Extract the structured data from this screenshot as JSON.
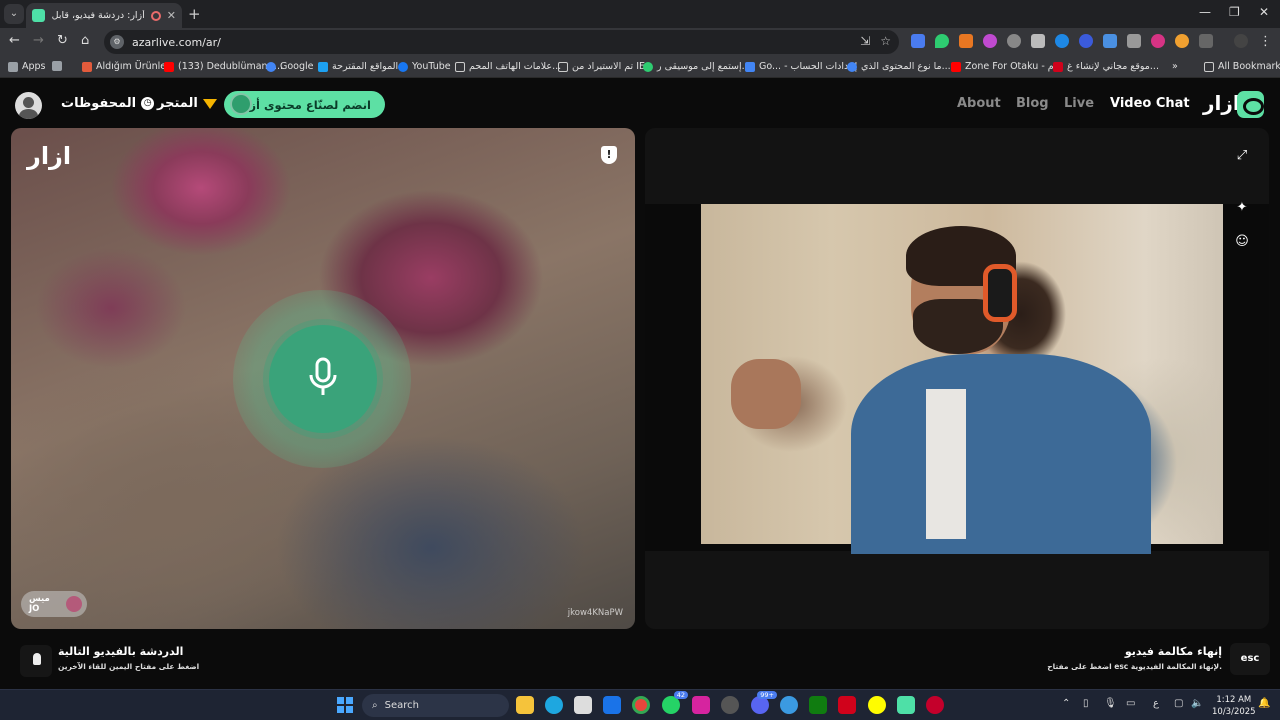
{
  "browser": {
    "tab_title": "أزار: دردشة فيديو، قابل الأصد...",
    "url": "azarlive.com/ar/",
    "bookmarks": [
      {
        "label": "Apps",
        "color": "#9aa0a6"
      },
      {
        "label": "Aldığım Ürünler",
        "color": "#e25b3c"
      },
      {
        "label": "(133) Dedublüman -...",
        "color": "#ff0000"
      },
      {
        "label": "Google",
        "color": "#4285f4"
      },
      {
        "label": "المواقع المقترحة",
        "color": "#1da1f2"
      },
      {
        "label": "YouTube",
        "color": "#1877f2"
      },
      {
        "label": "علامات الهاتف المحم...",
        "color": "#9aa0a6"
      },
      {
        "label": "تم الاستيراد من IE",
        "color": "#9aa0a6"
      },
      {
        "label": "إستمع إلى موسيقى ر...",
        "color": "#2ecc71"
      },
      {
        "label": "Go... - إعدادات الحساب",
        "color": "#4285f4"
      },
      {
        "label": "ما نوع المحتوى الذي...",
        "color": "#4285f4"
      },
      {
        "label": "Zone For Otaku - م...",
        "color": "#ff0000"
      },
      {
        "label": "موقع مجاني لإنشاء غ...",
        "color": "#d0021b"
      },
      {
        "label": "All Bookmarks",
        "color": "#9aa0a6"
      }
    ]
  },
  "header": {
    "saved_label": "المحفوظات",
    "store_label": "المتجر",
    "promo_label": "انضم لصنّاع محتوى أزار",
    "nav": {
      "about": "About",
      "blog": "Blog",
      "live": "Live",
      "video_chat": "Video Chat"
    },
    "logo_text": "ازار"
  },
  "left_video": {
    "watermark": "ازار",
    "report_icon": "!",
    "user_chip": {
      "name": "ميس",
      "country": "JO"
    },
    "user_id": "jkow4KNaPW"
  },
  "bottom": {
    "next_title": "الدردشة بالفيديو التالية",
    "next_sub": "اضغط على مفتاح اليمين للقاء الآخرين",
    "end_title": "إنهاء مكالمة فيديو",
    "end_sub": "اضغط على مفتاح esc لإنهاء المكالمة الفيديوية.",
    "esc_label": "esc"
  },
  "taskbar": {
    "search_placeholder": "Search",
    "whatsapp_badge": "42",
    "discord_badge": "99+",
    "lang": "ع",
    "time": "1:12 AM",
    "date": "10/3/2025"
  }
}
